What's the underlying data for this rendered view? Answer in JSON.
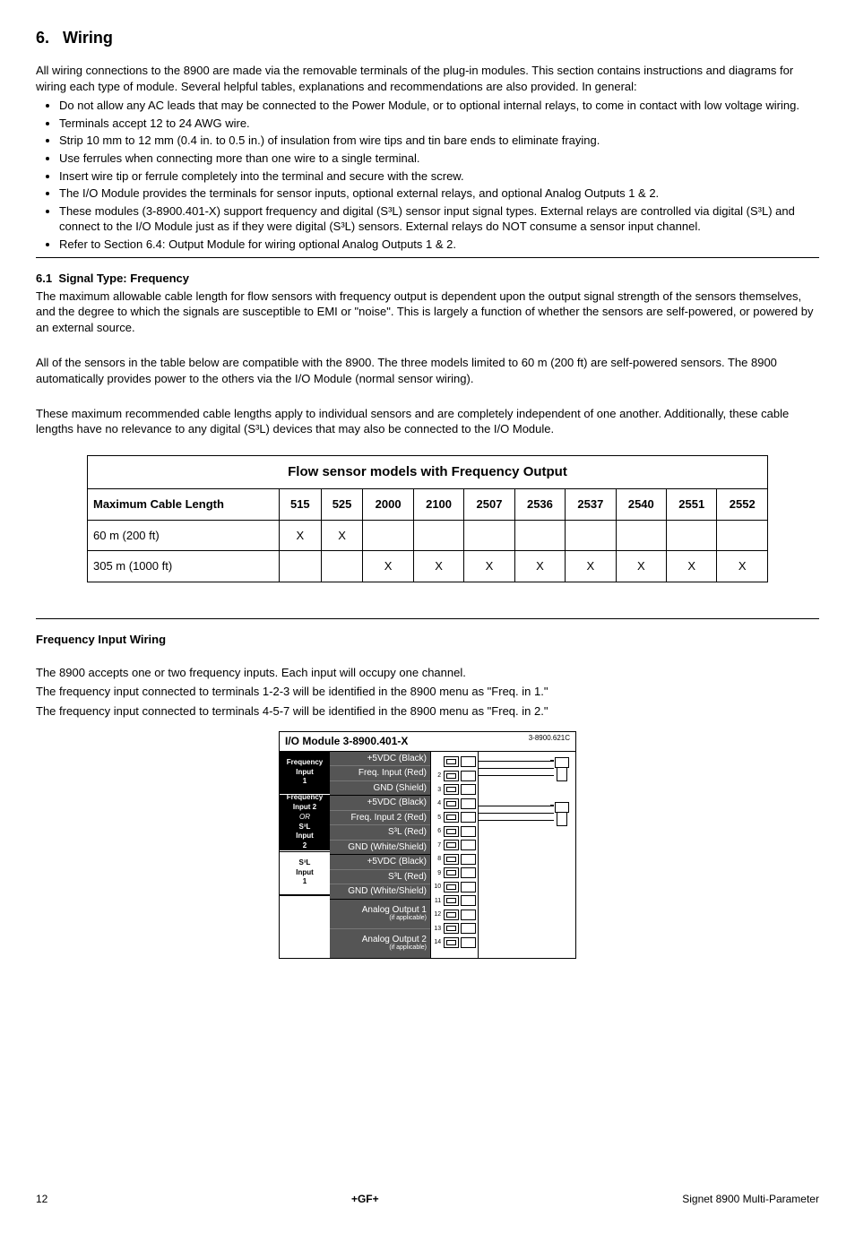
{
  "section": {
    "number": "6.",
    "title": "Wiring"
  },
  "intro": "All wiring connections to the 8900 are made via the removable terminals of the plug-in modules.  This section contains instructions and diagrams for wiring each type of module.  Several helpful tables, explanations and recommendations are also provided.  In general:",
  "bullets": [
    "Do not allow any AC leads that may be connected to the Power Module, or to optional internal relays, to come in contact with low voltage wiring.",
    "Terminals accept 12 to 24 AWG wire.",
    "Strip 10 mm to 12 mm (0.4 in. to 0.5 in.) of insulation from wire tips and tin bare ends to eliminate fraying.",
    "Use ferrules when connecting more than one wire to a single terminal.",
    "Insert wire tip or ferrule completely into the terminal and secure with the screw.",
    "The I/O Module provides the terminals for sensor inputs, optional external relays, and optional Analog Outputs 1 & 2.",
    "These modules (3-8900.401-X) support frequency and digital (S³L) sensor input signal types.  External relays are controlled via digital (S³L) and connect to the I/O Module just as if they were digital (S³L) sensors.  External relays do NOT consume a sensor input channel.",
    "Refer to Section 6.4: Output Module for wiring optional Analog Outputs 1 & 2."
  ],
  "subsection": {
    "num": "6.1",
    "title": "Signal Type: Frequency",
    "para1": "The maximum allowable cable length for flow sensors with frequency output is dependent upon the output signal strength of the sensors themselves, and the degree to which the signals are susceptible to EMI or \"noise\".  This is largely a function of whether the sensors are self-powered, or powered by an external source.",
    "para2": "All of the sensors in the table below are compatible with the 8900.  The three models limited to 60 m (200 ft) are self-powered sensors.  The 8900 automatically provides power to the others via the I/O Module (normal sensor wiring).",
    "para3": "These maximum recommended cable lengths apply to individual sensors and are completely independent of one another.  Additionally, these cable lengths have no relevance to any digital (S³L) devices that may also be connected to the I/O Module."
  },
  "table": {
    "caption": "Flow sensor models with Frequency Output",
    "row_header": "Maximum Cable Length",
    "columns": [
      "515",
      "525",
      "2000",
      "2100",
      "2507",
      "2536",
      "2537",
      "2540",
      "2551",
      "2552"
    ],
    "rows": [
      {
        "label": "60 m (200 ft)",
        "marks": [
          "X",
          "X",
          "",
          "",
          "",
          "",
          "",
          "",
          "",
          ""
        ]
      },
      {
        "label": "305 m (1000 ft)",
        "marks": [
          "",
          "",
          "X",
          "X",
          "X",
          "X",
          "X",
          "X",
          "X",
          "X"
        ]
      }
    ]
  },
  "freqwiring": {
    "heading": "Frequency Input Wiring",
    "p1": "The 8900 accepts one or two frequency inputs. Each input will occupy one channel.",
    "p2": "The frequency input connected to terminals 1-2-3 will be identified in the 8900 menu as \"Freq. in 1.\"",
    "p3": "The frequency input connected to terminals 4-5-7 will be identified in the 8900 menu as \"Freq. in 2.\""
  },
  "diagram": {
    "title": "I/O Module 3-8900.401-X",
    "code": "3-8900.621C",
    "groups": [
      {
        "label": [
          "Frequency",
          "Input",
          "1"
        ],
        "bg": "black",
        "signals": [
          "+5VDC (Black)",
          "Freq. Input (Red)",
          "GND (Shield)"
        ]
      },
      {
        "label": [
          "Frequency",
          "Input 2",
          "OR",
          "S³L",
          "Input",
          "2"
        ],
        "bg": "black",
        "signals": [
          "+5VDC (Black)",
          "Freq. Input 2 (Red)",
          "S³L (Red)",
          "GND (White/Shield)"
        ]
      },
      {
        "label": [
          "S³L",
          "Input",
          "1"
        ],
        "bg": "white",
        "signals": [
          "+5VDC (Black)",
          "S³L (Red)",
          "GND (White/Shield)"
        ]
      }
    ],
    "analog": [
      {
        "label": "Analog Output 1",
        "sub": "(if applicable)"
      },
      {
        "label": "Analog Output 2",
        "sub": "(if applicable)"
      }
    ],
    "terminals": 14
  },
  "footer": {
    "left": "12",
    "center": "+GF+",
    "right": "Signet 8900 Multi-Parameter"
  }
}
